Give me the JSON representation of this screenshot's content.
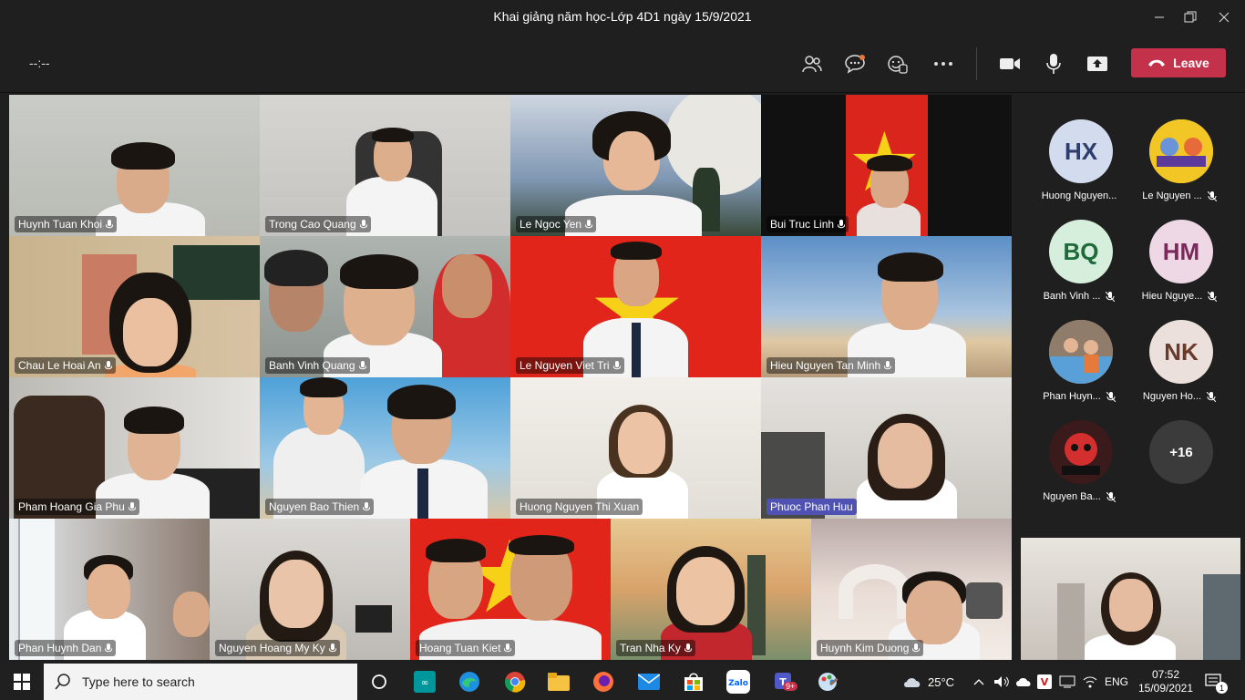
{
  "window": {
    "title": "Khai giảng năm học-Lớp 4D1 ngày 15/9/2021"
  },
  "toolbar": {
    "timer": "--:--",
    "leave_label": "Leave"
  },
  "colors": {
    "accent": "#4f52b2",
    "leave": "#c4314b"
  },
  "tiles": [
    {
      "name": "Huynh Tuan Khoi",
      "active": false
    },
    {
      "name": "Trong Cao Quang",
      "active": false
    },
    {
      "name": "Le Ngoc  Yen",
      "active": false
    },
    {
      "name": "Bui Truc Linh",
      "active": false
    },
    {
      "name": "Chau Le Hoai An",
      "active": false
    },
    {
      "name": "Banh Vinh Quang",
      "active": false
    },
    {
      "name": "Le Nguyen Viet Tri",
      "active": false
    },
    {
      "name": "Hieu Nguyen Tan Minh",
      "active": false
    },
    {
      "name": "Pham Hoang Gia Phu",
      "active": false
    },
    {
      "name": "Nguyen Bao Thien",
      "active": false
    },
    {
      "name": "Huong Nguyen Thi Xuan",
      "active": false
    },
    {
      "name": "Phuoc Phan Huu",
      "active": true
    },
    {
      "name": "Phan Huynh Dan",
      "active": false
    },
    {
      "name": "Nguyen Hoang My Ky",
      "active": false
    },
    {
      "name": "Hoang Tuan Kiet",
      "active": false
    },
    {
      "name": "Tran Nha Ky",
      "active": false
    },
    {
      "name": "Huynh Kim Duong",
      "active": false
    }
  ],
  "panel": [
    {
      "initials": "HX",
      "label": "Huong Nguyen...",
      "muted": false
    },
    {
      "initials": "",
      "label": "Le Nguyen ...",
      "muted": true
    },
    {
      "initials": "BQ",
      "label": "Banh Vinh ...",
      "muted": true
    },
    {
      "initials": "HM",
      "label": "Hieu Nguye...",
      "muted": true
    },
    {
      "initials": "",
      "label": "Phan Huyn...",
      "muted": true
    },
    {
      "initials": "NK",
      "label": "Nguyen Ho...",
      "muted": true
    },
    {
      "initials": "",
      "label": "Nguyen Ba...",
      "muted": true
    },
    {
      "initials": "+16",
      "label": "",
      "muted": false
    }
  ],
  "taskbar": {
    "search_placeholder": "Type here to search",
    "weather": "25°C",
    "lang": "ENG",
    "time": "07:52",
    "date": "15/09/2021",
    "notif_count": "1",
    "teams_badge": "9+"
  }
}
